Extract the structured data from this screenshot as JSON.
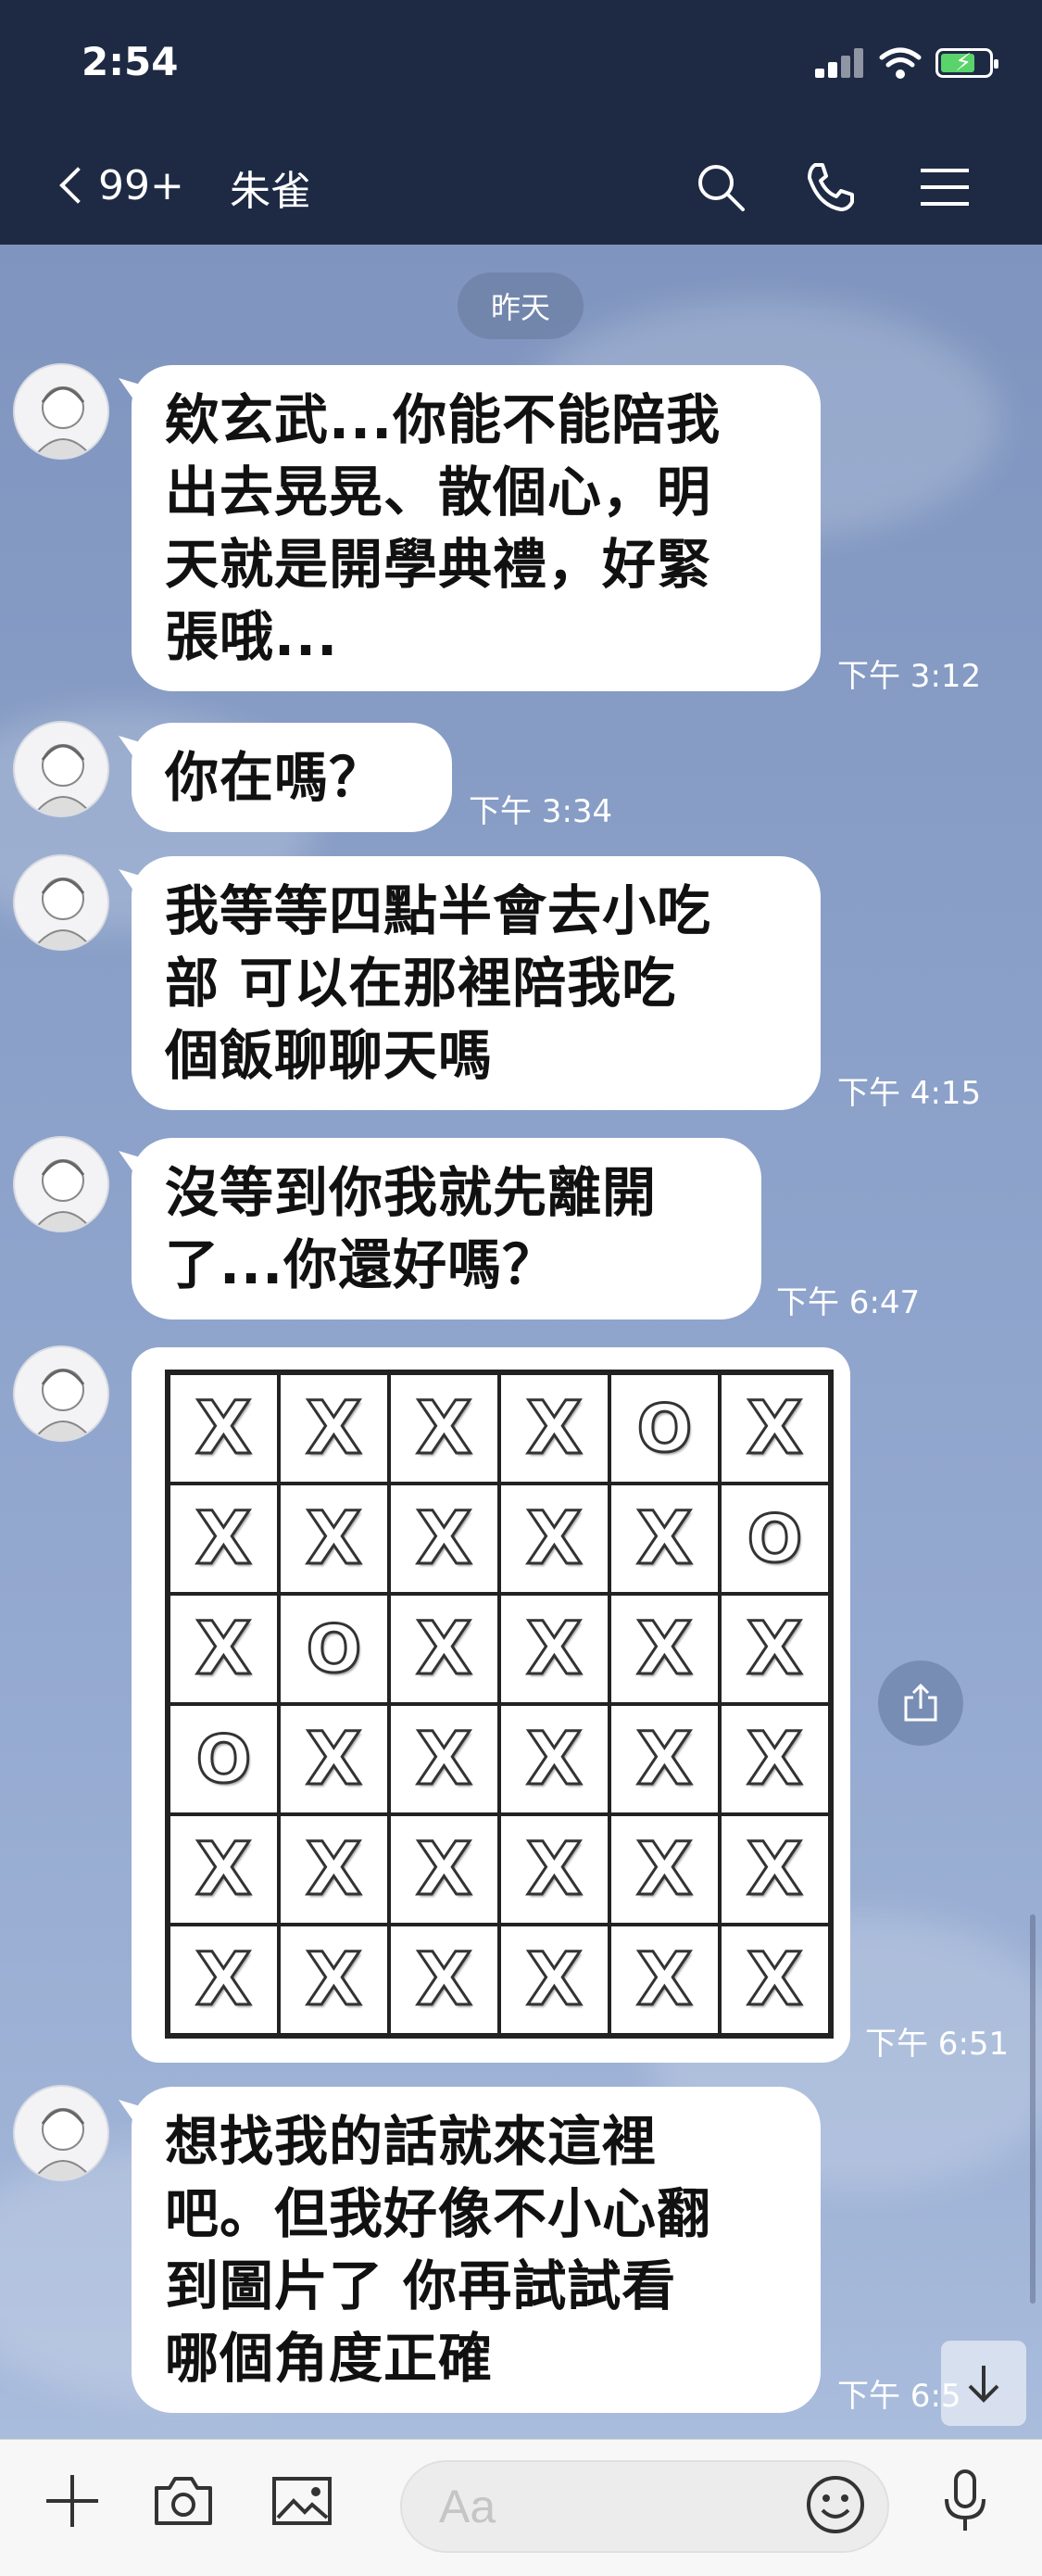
{
  "status": {
    "time": "2:54"
  },
  "header": {
    "unread": "99+",
    "title": "朱雀"
  },
  "date_divider": "昨天",
  "messages": [
    {
      "text": "欸玄武...你能不能陪我出去晃晃、散個心，明天就是開學典禮，好緊張哦...",
      "lines": [
        "欸玄武...你能不能陪我",
        "出去晃晃、散個心，明",
        "天就是開學典禮，好緊",
        "張哦..."
      ],
      "time": "下午 3:12"
    },
    {
      "text": "你在嗎？",
      "lines": [
        "你在嗎？"
      ],
      "time": "下午 3:34"
    },
    {
      "text": "我等等四點半會去小吃部 可以在那裡陪我吃個飯聊聊天嗎",
      "lines": [
        "我等等四點半會去小吃",
        "部 可以在那裡陪我吃",
        "個飯聊聊天嗎"
      ],
      "time": "下午 4:15"
    },
    {
      "text": "沒等到你我就先離開了...你還好嗎？",
      "lines": [
        "沒等到你我就先離開",
        "了...你還好嗎？"
      ],
      "time": "下午 6:47"
    },
    {
      "text": "想找我的話就來這裡吧。但我好像不小心翻到圖片了 你再試試看哪個角度正確",
      "lines": [
        "想找我的話就來這裡",
        "吧。但我好像不小心翻",
        "到圖片了 你再試試看",
        "哪個角度正確"
      ],
      "time": "下午 6:5"
    }
  ],
  "image_message": {
    "time": "下午 6:51",
    "grid": [
      [
        "X",
        "X",
        "X",
        "X",
        "O",
        "X"
      ],
      [
        "X",
        "X",
        "X",
        "X",
        "X",
        "O"
      ],
      [
        "X",
        "O",
        "X",
        "X",
        "X",
        "X"
      ],
      [
        "O",
        "X",
        "X",
        "X",
        "X",
        "X"
      ],
      [
        "X",
        "X",
        "X",
        "X",
        "X",
        "X"
      ],
      [
        "X",
        "X",
        "X",
        "X",
        "X",
        "X"
      ]
    ]
  },
  "input": {
    "placeholder": "Aa"
  },
  "colors": {
    "header": "#1e2a44",
    "bubble": "#ffffff",
    "battery": "#59d36a"
  },
  "icons": [
    "back-chevron-icon",
    "search-icon",
    "phone-icon",
    "menu-icon",
    "plus-icon",
    "camera-icon",
    "image-icon",
    "emoji-icon",
    "mic-icon",
    "share-icon",
    "arrow-down-icon"
  ]
}
